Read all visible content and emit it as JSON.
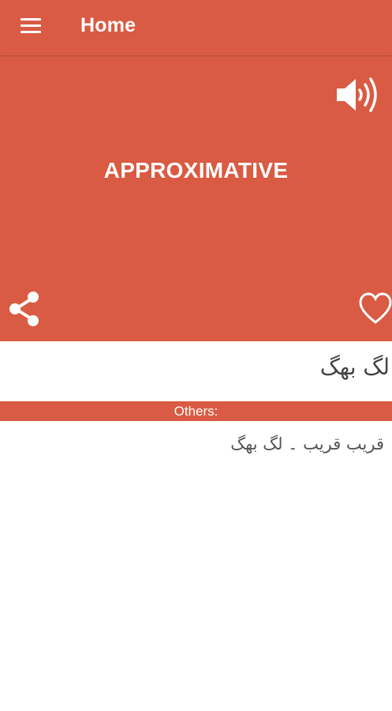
{
  "app_bar": {
    "title": "Home",
    "menu_icon": "hamburger-menu-icon"
  },
  "word_card": {
    "word": "APPROXIMATIVE",
    "speaker_icon": "speaker-volume-icon",
    "share_icon": "share-icon",
    "favorite_icon": "heart-outline-icon"
  },
  "translation": {
    "text": "لگ بھگ"
  },
  "others": {
    "label": "Others:",
    "text": "قریب قریب ۔ لگ بھگ"
  },
  "colors": {
    "primary": "#d95b43",
    "text_dark": "#444444",
    "background": "#ffffff"
  }
}
